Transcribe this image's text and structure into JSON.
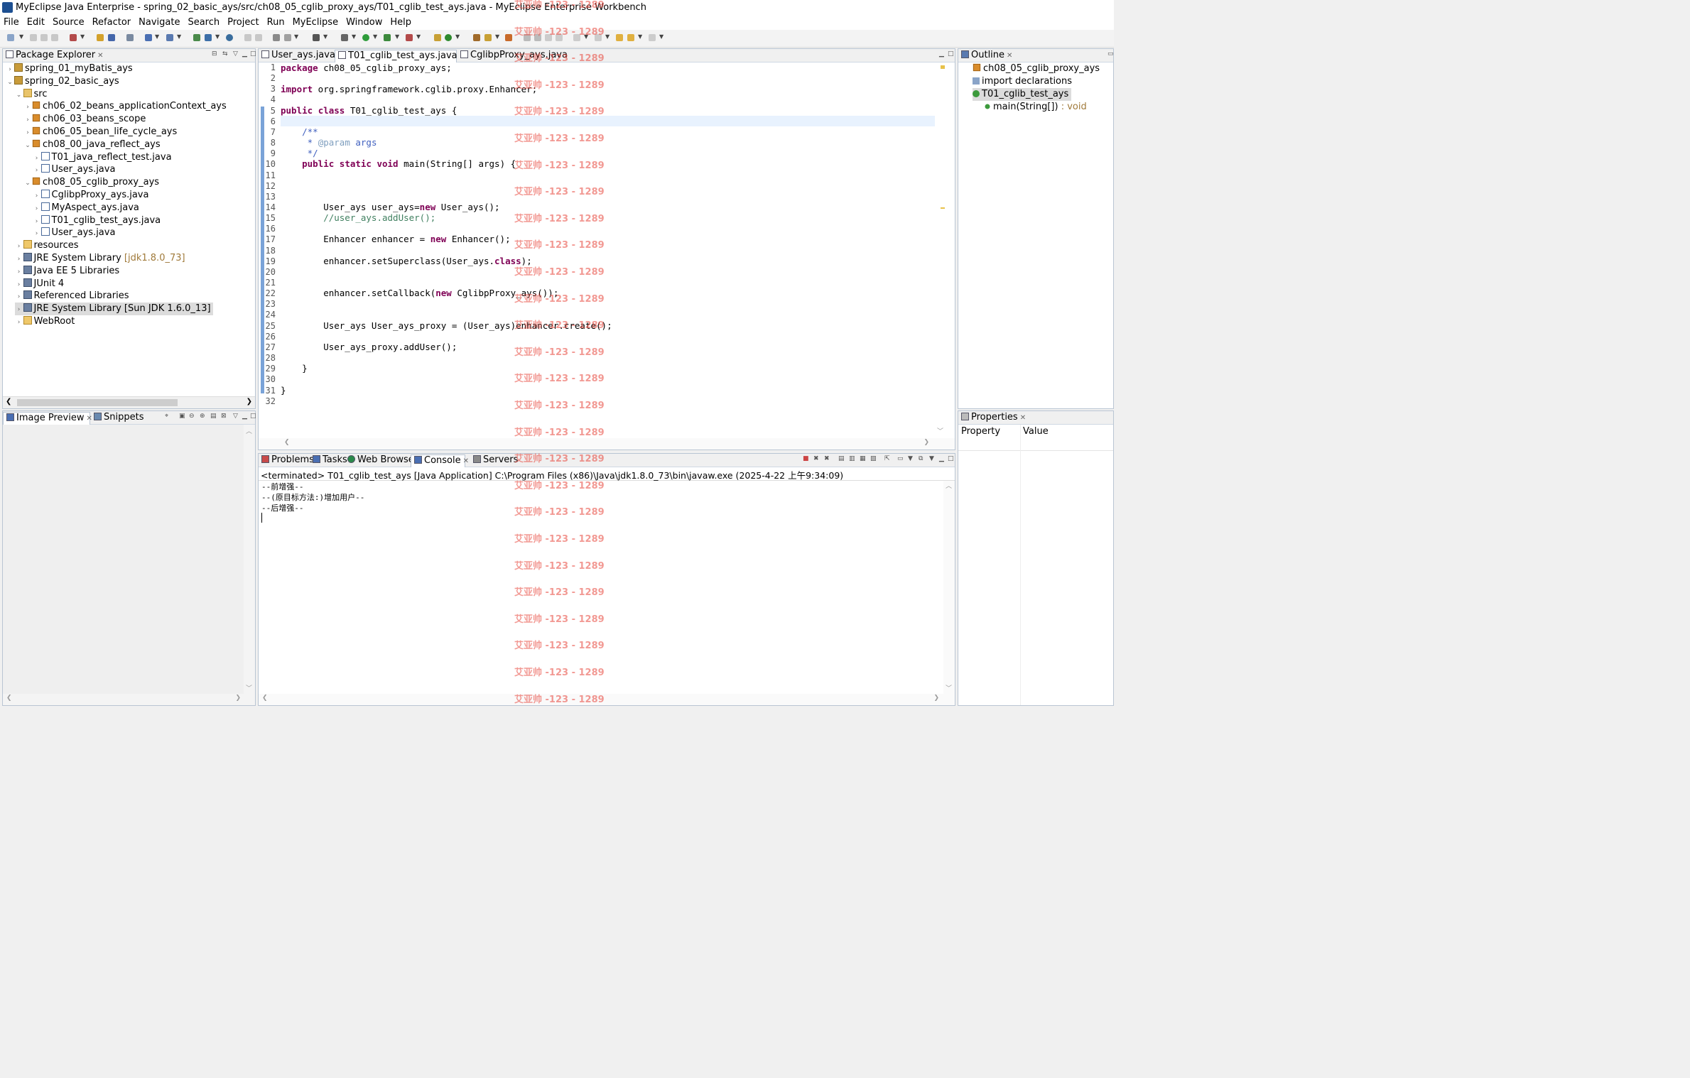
{
  "window": {
    "title": "MyEclipse Java Enterprise - spring_02_basic_ays/src/ch08_05_cglib_proxy_ays/T01_cglib_test_ays.java - MyEclipse Enterprise Workbench"
  },
  "menu": [
    "File",
    "Edit",
    "Source",
    "Refactor",
    "Navigate",
    "Search",
    "Project",
    "Run",
    "MyEclipse",
    "Window",
    "Help"
  ],
  "package_explorer": {
    "tab": "Package Explorer",
    "items": [
      {
        "label": "spring_01_myBatis_ays",
        "icon": "project-icon"
      },
      {
        "label": "spring_02_basic_ays",
        "icon": "project-icon"
      },
      {
        "label": "src",
        "icon": "source-folder-icon"
      },
      {
        "label": "ch06_02_beans_applicationContext_ays",
        "icon": "package-icon"
      },
      {
        "label": "ch06_03_beans_scope",
        "icon": "package-icon"
      },
      {
        "label": "ch06_05_bean_life_cycle_ays",
        "icon": "package-icon"
      },
      {
        "label": "ch08_00_java_reflect_ays",
        "icon": "package-icon"
      },
      {
        "label": "T01_java_reflect_test.java",
        "icon": "java-file-icon"
      },
      {
        "label": "User_ays.java",
        "icon": "java-file-icon"
      },
      {
        "label": "ch08_05_cglib_proxy_ays",
        "icon": "package-icon"
      },
      {
        "label": "CglibpProxy_ays.java",
        "icon": "java-file-icon"
      },
      {
        "label": "MyAspect_ays.java",
        "icon": "java-file-icon"
      },
      {
        "label": "T01_cglib_test_ays.java",
        "icon": "java-file-icon"
      },
      {
        "label": "User_ays.java",
        "icon": "java-file-icon"
      },
      {
        "label": "resources",
        "icon": "folder-icon"
      },
      {
        "label": "JRE System Library",
        "suffix": "[jdk1.8.0_73]",
        "icon": "library-icon"
      },
      {
        "label": "Java EE 5 Libraries",
        "icon": "library-icon"
      },
      {
        "label": "JUnit 4",
        "icon": "library-icon"
      },
      {
        "label": "Referenced Libraries",
        "icon": "library-icon"
      },
      {
        "label": "JRE System Library [Sun JDK 1.6.0_13]",
        "icon": "library-icon"
      },
      {
        "label": "WebRoot",
        "icon": "folder-icon"
      }
    ]
  },
  "image_preview": {
    "tab1": "Image Preview",
    "tab2": "Snippets"
  },
  "editor": {
    "tabs": [
      "User_ays.java",
      "T01_cglib_test_ays.java",
      "CglibpProxy_ays.java"
    ],
    "line_count": 32
  },
  "outline": {
    "tab": "Outline",
    "items": [
      "ch08_05_cglib_proxy_ays",
      "import declarations",
      "T01_cglib_test_ays",
      "main(String[])",
      ": void"
    ]
  },
  "properties": {
    "tab": "Properties",
    "col1": "Property",
    "col2": "Value"
  },
  "bottom": {
    "tabs": [
      "Problems",
      "Tasks",
      "Web Browser",
      "Console",
      "Servers"
    ],
    "status": "<terminated> T01_cglib_test_ays [Java Application] C:\\Program Files (x86)\\Java\\jdk1.8.0_73\\bin\\javaw.exe (2025-4-22 上午9:34:09)",
    "output": [
      "--前增强--",
      "--(原目标方法:)增加用户--",
      "--后增强--"
    ]
  },
  "watermark": "艾亚帅 -123 - 1289"
}
